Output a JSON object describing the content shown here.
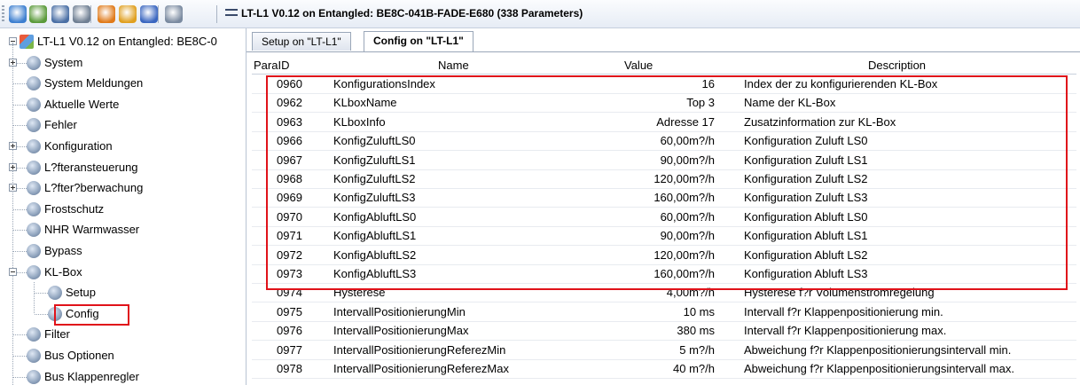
{
  "window": {
    "title": "LT-L1 V0.12 on Entangled: BE8C-041B-FADE-E680 (338 Parameters)"
  },
  "toolbar": {
    "buttons": [
      {
        "name": "connect-icon",
        "color": "#3d7fd0"
      },
      {
        "name": "settings-icon",
        "color": "#5a9a3a"
      },
      {
        "name": "save-icon",
        "color": "#4a6fa5"
      },
      {
        "name": "print-icon",
        "color": "#6f7f93"
      },
      {
        "name": "fire-icon",
        "color": "#e07a1a"
      },
      {
        "name": "refresh-icon",
        "color": "#e0a020"
      },
      {
        "name": "undo-icon",
        "color": "#3a66c0"
      },
      {
        "name": "delete-icon",
        "color": "#7a8aa0"
      }
    ]
  },
  "tree": {
    "root": "LT-L1 V0.12 on Entangled: BE8C-0",
    "items": [
      {
        "label": "System",
        "expandable": true
      },
      {
        "label": "System Meldungen",
        "expandable": false
      },
      {
        "label": "Aktuelle Werte",
        "expandable": false
      },
      {
        "label": "Fehler",
        "expandable": false
      },
      {
        "label": "Konfiguration",
        "expandable": true
      },
      {
        "label": "L?fteransteuerung",
        "expandable": true
      },
      {
        "label": "L?fter?berwachung",
        "expandable": true
      },
      {
        "label": "Frostschutz",
        "expandable": false
      },
      {
        "label": "NHR Warmwasser",
        "expandable": false
      },
      {
        "label": "Bypass",
        "expandable": false
      },
      {
        "label": "KL-Box",
        "expandable": true,
        "expanded": true
      },
      {
        "label": "Setup",
        "child": true
      },
      {
        "label": "Config",
        "child": true,
        "selected": true
      },
      {
        "label": "Filter",
        "expandable": false
      },
      {
        "label": "Bus Optionen",
        "expandable": false
      },
      {
        "label": "Bus Klappenregler",
        "expandable": false
      }
    ]
  },
  "tabs": [
    {
      "label": "Setup on \"LT-L1\"",
      "active": false
    },
    {
      "label": "Config on \"LT-L1\"",
      "active": true
    }
  ],
  "table": {
    "columns": {
      "id": "ParaID",
      "name": "Name",
      "value": "Value",
      "description": "Description"
    },
    "rows": [
      {
        "id": "0960",
        "name": "KonfigurationsIndex",
        "value": "16",
        "description": "Index der zu konfigurierenden KL-Box"
      },
      {
        "id": "0962",
        "name": "KLboxName",
        "value": "Top 3",
        "description": "Name der KL-Box"
      },
      {
        "id": "0963",
        "name": "KLboxInfo",
        "value": "Adresse 17",
        "description": "Zusatzinformation zur KL-Box"
      },
      {
        "id": "0966",
        "name": "KonfigZuluftLS0",
        "value": "60,00m?/h",
        "description": "Konfiguration Zuluft LS0"
      },
      {
        "id": "0967",
        "name": "KonfigZuluftLS1",
        "value": "90,00m?/h",
        "description": "Konfiguration Zuluft LS1"
      },
      {
        "id": "0968",
        "name": "KonfigZuluftLS2",
        "value": "120,00m?/h",
        "description": "Konfiguration Zuluft LS2"
      },
      {
        "id": "0969",
        "name": "KonfigZuluftLS3",
        "value": "160,00m?/h",
        "description": "Konfiguration Zuluft LS3"
      },
      {
        "id": "0970",
        "name": "KonfigAbluftLS0",
        "value": "60,00m?/h",
        "description": "Konfiguration Abluft LS0"
      },
      {
        "id": "0971",
        "name": "KonfigAbluftLS1",
        "value": "90,00m?/h",
        "description": "Konfiguration Abluft LS1"
      },
      {
        "id": "0972",
        "name": "KonfigAbluftLS2",
        "value": "120,00m?/h",
        "description": "Konfiguration Abluft LS2"
      },
      {
        "id": "0973",
        "name": "KonfigAbluftLS3",
        "value": "160,00m?/h",
        "description": "Konfiguration Abluft LS3"
      },
      {
        "id": "0974",
        "name": "Hysterese",
        "value": "4,00m?/h",
        "description": "Hysterese f?r Volumenstromregelung"
      },
      {
        "id": "0975",
        "name": "IntervallPositionierungMin",
        "value": "10 ms",
        "description": "Intervall f?r Klappenpositionierung min."
      },
      {
        "id": "0976",
        "name": "IntervallPositionierungMax",
        "value": "380 ms",
        "description": "Intervall f?r Klappenpositionierung max."
      },
      {
        "id": "0977",
        "name": "IntervallPositionierungReferezMin",
        "value": "5 m?/h",
        "description": "Abweichung f?r Klappenpositionierungsintervall min."
      },
      {
        "id": "0978",
        "name": "IntervallPositionierungReferezMax",
        "value": "40 m?/h",
        "description": "Abweichung f?r Klappenpositionierungsintervall max."
      }
    ]
  },
  "colors": {
    "highlight": "#e0121a",
    "toolbar_top": "#fbfcfe",
    "toolbar_bottom": "#e6ecf5"
  }
}
